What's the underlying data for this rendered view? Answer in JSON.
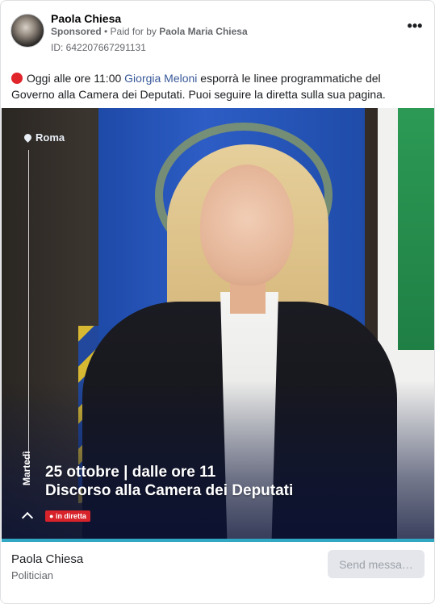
{
  "post": {
    "author_name": "Paola Chiesa",
    "sponsored_label": "Sponsored",
    "separator": " • ",
    "paid_for_prefix": "Paid for by ",
    "payer_name": "Paola Maria Chiesa",
    "ad_id": "ID: 642207667291131",
    "more_label": "•••",
    "body_before": "Oggi alle ore 11:00 ",
    "mention": "Giorgia Meloni",
    "body_after": " esporrà le linee programmatiche del Governo alla Camera dei Deputati. Puoi seguire la diretta sulla sua pagina."
  },
  "media": {
    "location": "Roma",
    "weekday": "Martedì",
    "headline_line1": "25 ottobre | dalle ore 11",
    "headline_line2": "Discorso alla Camera dei Deputati",
    "live_badge": "in diretta"
  },
  "footer": {
    "page_name": "Paola Chiesa",
    "page_category": "Politician",
    "send_button": "Send messa…"
  },
  "colors": {
    "live_red": "#e0252b",
    "mention_blue": "#385898",
    "flag_blue": "#1e4aa8"
  }
}
